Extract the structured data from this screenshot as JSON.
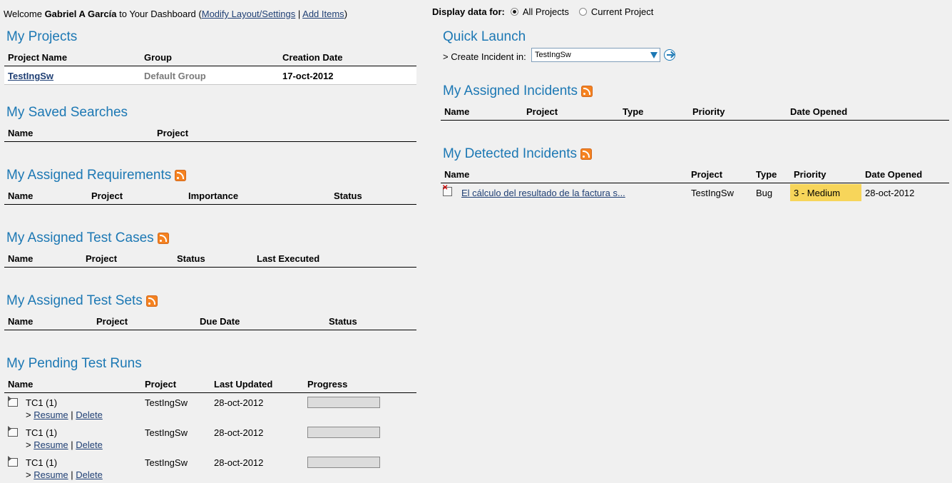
{
  "header": {
    "welcome_prefix": "Welcome ",
    "user_name": "Gabriel A García",
    "welcome_suffix": " to Your Dashboard (",
    "modify_link": "Modify Layout/Settings",
    "separator": " | ",
    "add_link": "Add Items",
    "close_paren": ")"
  },
  "display": {
    "label": "Display data for:",
    "options": [
      {
        "label": "All Projects",
        "selected": true
      },
      {
        "label": "Current Project",
        "selected": false
      }
    ]
  },
  "my_projects": {
    "title": "My Projects",
    "columns": [
      "Project Name",
      "Group",
      "Creation Date"
    ],
    "rows": [
      {
        "name": "TestIngSw",
        "group": "Default Group",
        "date": "17-oct-2012"
      }
    ]
  },
  "saved_searches": {
    "title": "My Saved Searches",
    "columns": [
      "Name",
      "Project"
    ]
  },
  "assigned_requirements": {
    "title": "My Assigned Requirements",
    "columns": [
      "Name",
      "Project",
      "Importance",
      "Status"
    ]
  },
  "assigned_test_cases": {
    "title": "My Assigned Test Cases",
    "columns": [
      "Name",
      "Project",
      "Status",
      "Last Executed"
    ]
  },
  "assigned_test_sets": {
    "title": "My Assigned Test Sets",
    "columns": [
      "Name",
      "Project",
      "Due Date",
      "Status"
    ]
  },
  "pending_test_runs": {
    "title": "My Pending Test Runs",
    "columns": [
      "Name",
      "Project",
      "Last Updated",
      "Progress"
    ],
    "action_prefix": "> ",
    "resume_label": "Resume",
    "sep": " | ",
    "delete_label": "Delete",
    "rows": [
      {
        "name": "TC1 (1)",
        "project": "TestIngSw",
        "updated": "28-oct-2012",
        "progress": 0
      },
      {
        "name": "TC1 (1)",
        "project": "TestIngSw",
        "updated": "28-oct-2012",
        "progress": 0
      },
      {
        "name": "TC1 (1)",
        "project": "TestIngSw",
        "updated": "28-oct-2012",
        "progress": 0
      }
    ]
  },
  "quick_launch": {
    "title": "Quick Launch",
    "create_label": "> Create Incident in:",
    "selected_project": "TestIngSw"
  },
  "assigned_incidents": {
    "title": "My Assigned Incidents",
    "columns": [
      "Name",
      "Project",
      "Type",
      "Priority",
      "Date Opened"
    ]
  },
  "detected_incidents": {
    "title": "My Detected Incidents",
    "columns": [
      "Name",
      "Project",
      "Type",
      "Priority",
      "Date Opened"
    ],
    "rows": [
      {
        "name": "El cálculo del resultado de la factura s...",
        "project": "TestIngSw",
        "type": "Bug",
        "priority": "3 - Medium",
        "date": "28-oct-2012"
      }
    ]
  },
  "colors": {
    "title_blue": "#1c78b4",
    "priority_medium": "#f7d55a",
    "rss_orange": "#f58220"
  }
}
